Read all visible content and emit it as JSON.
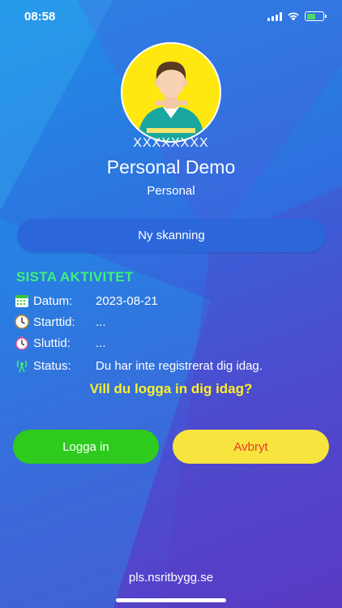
{
  "status_bar": {
    "time": "08:58"
  },
  "profile": {
    "username": "XXXXXXXX",
    "display_name": "Personal Demo",
    "role": "Personal"
  },
  "scan_button_label": "Ny skanning",
  "activity": {
    "title": "SISTA AKTIVITET",
    "rows": [
      {
        "icon": "calendar-icon",
        "label": "Datum:",
        "value": "2023-08-21"
      },
      {
        "icon": "clock-icon",
        "label": "Starttid:",
        "value": "..."
      },
      {
        "icon": "stopwatch-icon",
        "label": "Sluttid:",
        "value": "..."
      },
      {
        "icon": "antenna-icon",
        "label": "Status:",
        "value": "Du har inte registrerat dig idag."
      }
    ]
  },
  "question": "Vill du logga in dig idag?",
  "buttons": {
    "login_label": "Logga in",
    "cancel_label": "Avbryt"
  },
  "footer_link": "pls.nsritbygg.se",
  "colors": {
    "activity_title": "#3ff07a",
    "question": "#ffee2a",
    "login_button": "#2ecb1e",
    "cancel_button": "#f7e43f",
    "cancel_text": "#e53b2a",
    "scan_button": "#2b67da",
    "avatar_bg": "#ffe80f"
  }
}
